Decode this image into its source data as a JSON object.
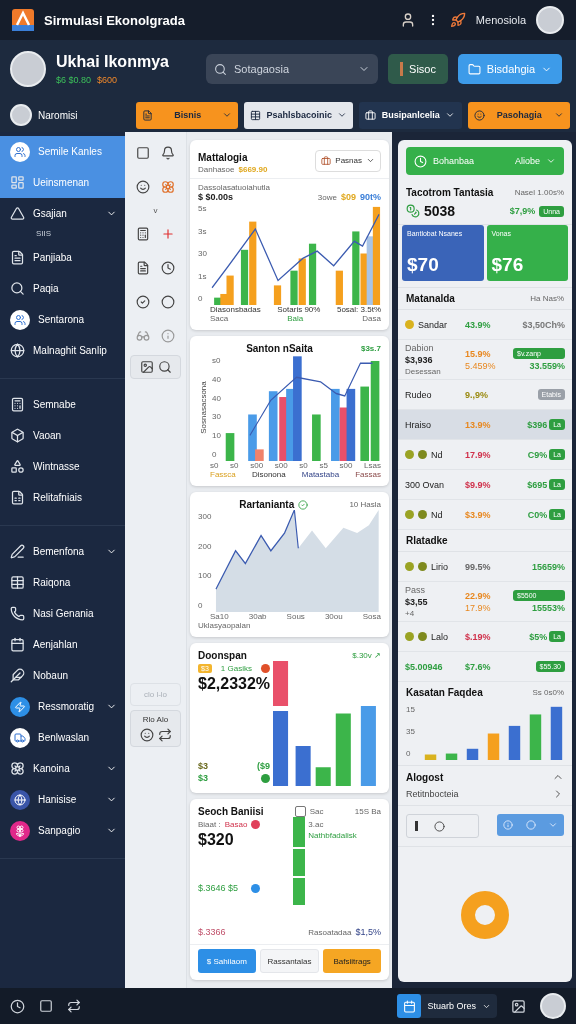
{
  "topbar": {
    "title": "Sirmulasi Ekonolgrada",
    "user_label": "Menosiola"
  },
  "profile": {
    "name": "Ukhai Ikonmya",
    "stat_green": "$6 $0.80",
    "stat_orange": "$600"
  },
  "search": {
    "placeholder": "Sotagaosia"
  },
  "header_buttons": [
    {
      "label": "Sisoc",
      "kind": "plain"
    },
    {
      "label": "Bisdahgia",
      "kind": "dropdown"
    }
  ],
  "subbar": {
    "user": "Naromisi",
    "dropdowns": [
      {
        "label": "Bisnis",
        "color": "#f7931e"
      },
      {
        "label": "Psahlsbacoinic",
        "color": "#e4e7ec"
      },
      {
        "label": "Busipanlcelia",
        "color": "#22344f"
      },
      {
        "label": "Pasohagia",
        "color": "#f7931e"
      }
    ]
  },
  "sidebar": {
    "sections": [
      [
        {
          "label": "Semile Kanles",
          "selected": true,
          "expandable": false,
          "color": "#ffffff"
        },
        {
          "label": "Ueinsmenan",
          "selected": true,
          "expandable": false
        },
        {
          "label": "Gsajian",
          "selected": false,
          "expandable": true,
          "sub": "SIIS"
        },
        {
          "label": "Panjiaba",
          "selected": false,
          "expandable": false
        },
        {
          "label": "Paqia",
          "selected": false,
          "expandable": false
        },
        {
          "label": "Sentarona",
          "selected": false,
          "expandable": false,
          "color": "#ffffff"
        },
        {
          "label": "Malnaghit Sanlip",
          "selected": false,
          "expandable": false
        }
      ],
      [
        {
          "label": "Semnabe",
          "selected": false,
          "expandable": false
        },
        {
          "label": "Vaoan",
          "selected": false,
          "expandable": false
        },
        {
          "label": "Wintnasse",
          "selected": false,
          "expandable": false
        },
        {
          "label": "Relitafniais",
          "selected": false,
          "expandable": false
        }
      ],
      [
        {
          "label": "Bemenfona",
          "selected": false,
          "expandable": true
        },
        {
          "label": "Raiqona",
          "selected": false,
          "expandable": false
        },
        {
          "label": "Nasi Genania",
          "selected": false,
          "expandable": false
        },
        {
          "label": "Aenjahlan",
          "selected": false,
          "expandable": false
        },
        {
          "label": "Nobaun",
          "selected": false,
          "expandable": false
        },
        {
          "label": "Ressmoratig",
          "selected": false,
          "expandable": true,
          "color": "#2d8fe6"
        },
        {
          "label": "Benlwaslan",
          "selected": false,
          "expandable": false,
          "color": "#ffffff"
        },
        {
          "label": "Kanoina",
          "selected": false,
          "expandable": true
        },
        {
          "label": "Hanisise",
          "selected": false,
          "expandable": true,
          "color": "#3a55a8"
        },
        {
          "label": "Sanpagio",
          "selected": false,
          "expandable": true,
          "color": "#e0288a"
        }
      ]
    ]
  },
  "tool_panel": {
    "arrow": "v",
    "faded": "clo l-lo",
    "box_label": "Rlo Alo"
  },
  "trend_card": {
    "title": "Mattalogia",
    "subtitle": "Danhasoe",
    "subtitle_value": "$669.90",
    "dropdown": "Pasnas",
    "caption": "Dassolasatuoiahutla",
    "value": "$ $0.00s",
    "stat_1": "3owe",
    "stat_2": "$09",
    "stat_3": "90t%",
    "yticks": [
      "5s",
      "3s",
      "30",
      "1s",
      "0"
    ],
    "xlabels": [
      "Diasonsbadas",
      "Sotaris 90%",
      "5osal: 3.5t%"
    ],
    "xsublabels": [
      "Saca",
      "Bala",
      "Dasa"
    ]
  },
  "sales_card": {
    "title": "Santon nSaita",
    "value": "$3s.7",
    "ylabel": "Sosnasacsona",
    "yticks": [
      "s0",
      "40",
      "40",
      "30",
      "10",
      "0"
    ],
    "xlabels": [
      "s0",
      "s0",
      "s00",
      "s00",
      "s0",
      "s5",
      "s00",
      "Lsas"
    ],
    "legend": [
      "Fassca",
      "Disonona",
      "Matastaba",
      "Fassas"
    ]
  },
  "area_card": {
    "title": "Rartanianta",
    "meta": "10 Hasla",
    "yticks": [
      "300",
      "200",
      "100",
      "0"
    ],
    "xlabels": [
      "Sa10",
      "30ab",
      "Sous",
      "30ou",
      "Sosa"
    ],
    "caption": "Uklasyaopalan"
  },
  "overview_card": {
    "title": "Doonspan",
    "trend": "$.30v ↗",
    "tag": "$3",
    "tag_text": "1 Gasiks",
    "value": "$2,2332%",
    "mini_1": "$3",
    "mini_2": "($9",
    "mini_3": "$3"
  },
  "summary_card": {
    "title": "Seoch Baniisi",
    "check_label": "Sac",
    "checked": false,
    "meta": "15S Ba",
    "note_label": "Biaat :",
    "note_value": "Basao",
    "note_right": "3.ac",
    "value": "$320",
    "green_value": "$.3646 $5",
    "red_value": "$.3366",
    "bar_top": "Nathbfadalisk",
    "bar_bottom": "Rasoatadaa",
    "bar_pct": "$1,5%",
    "buttons": [
      {
        "label": "$ Sahiiaom",
        "kind": "primary"
      },
      {
        "label": "Rassantalas",
        "kind": "secondary"
      },
      {
        "label": "Bafsiitrags",
        "kind": "warning"
      }
    ]
  },
  "right_panel": {
    "selector": {
      "label": "Bohanbaa",
      "value": "Aliobe"
    },
    "summary": {
      "title": "Tacotrom Tantasia",
      "meta": "Nasel 1.00s%",
      "value": "5038",
      "change": "$7,9%",
      "badge": "Unna"
    },
    "tiles": [
      {
        "label": "Bantlobat Nsanes",
        "value": "$70",
        "color": "#3a64b8"
      },
      {
        "label": "Vonas",
        "value": "$76",
        "color": "#35b04a"
      }
    ],
    "market": {
      "title": "Matanalda",
      "meta": "Ha Nas%",
      "rows": [
        {
          "kind": "icon",
          "label": "Sandar",
          "pct": {
            "text": "43.9%",
            "color": "#2e9e40"
          },
          "value": {
            "text": "$3,50Ch%",
            "color": "#777777"
          },
          "selected": false
        },
        {
          "kind": "stacked",
          "label": "Dabion",
          "label_2": "$3,936",
          "note": "Desessan",
          "pct": {
            "text": "15.9%",
            "color": "#e8871e"
          },
          "pct_2": "5.459%",
          "badge": {
            "text": "$v.zanp",
            "color": "#2e9e40"
          },
          "value": {
            "text": "33.559%",
            "color": "#2e9e40"
          },
          "selected": false
        },
        {
          "kind": "plain",
          "label": "Rudeo",
          "pct": {
            "text": "9.,9%",
            "color": "#9a8a10"
          },
          "badge": {
            "text": "Etabis",
            "color": "#9aa0a8"
          },
          "selected": false
        },
        {
          "kind": "plain",
          "label": "Hraiso",
          "pct": {
            "text": "13.9%",
            "color": "#e8871e"
          },
          "value": {
            "text": "$396",
            "color": "#2e9e40"
          },
          "badge": {
            "text": "La",
            "color": "#2e9e40"
          },
          "selected": true
        },
        {
          "kind": "two_icon",
          "label": "Nd",
          "pct": {
            "text": "17.9%",
            "color": "#d0304a"
          },
          "value": {
            "text": "C9%",
            "color": "#2e9e40"
          },
          "badge": {
            "text": "La",
            "color": "#2e9e40"
          },
          "selected": false
        },
        {
          "kind": "plain",
          "label": "300 Ovan",
          "pct": {
            "text": "$9.9%",
            "color": "#d0304a"
          },
          "value": {
            "text": "$695",
            "color": "#2e9e40"
          },
          "badge": {
            "text": "La",
            "color": "#2e9e40"
          },
          "selected": false
        },
        {
          "kind": "two_icon",
          "label": "Nd",
          "pct": {
            "text": "$3.9%",
            "color": "#e8871e"
          },
          "value": {
            "text": "C0%",
            "color": "#2e9e40"
          },
          "badge": {
            "text": "La",
            "color": "#2e9e40"
          },
          "selected": false
        }
      ]
    },
    "history": {
      "title": "Rlatadke",
      "rows": [
        {
          "kind": "two_icon",
          "label": "Lirio",
          "pct": {
            "text": "99.5%",
            "color": "#666666"
          },
          "value": {
            "text": "15659%",
            "color": "#2e9e40"
          },
          "selected": false
        },
        {
          "kind": "stacked",
          "label": "Pass",
          "label_2": "$3,55",
          "note": "+4",
          "pct": {
            "text": "22.9%",
            "color": "#e8871e"
          },
          "pct_2": "17.9%",
          "badge": {
            "text": "$5500",
            "color": "#2e9e40"
          },
          "value": {
            "text": "15553%",
            "color": "#2e9e40"
          },
          "selected": false
        },
        {
          "kind": "two_icon",
          "label": "Lalo",
          "pct": {
            "text": "$.19%",
            "color": "#d0304a"
          },
          "value": {
            "text": "$5%",
            "color": "#2e9e40"
          },
          "badge": {
            "text": "La",
            "color": "#2e9e40"
          },
          "selected": false
        },
        {
          "kind": "highlight",
          "label": "$5.00946",
          "pct": {
            "text": "$7.6%",
            "color": "#2e9e40"
          },
          "badge": {
            "text": "$55.30",
            "color": "#2e9e40"
          },
          "selected": false
        }
      ]
    },
    "growth": {
      "title": "Kasatan Faqdea",
      "meta": "Ss 0s0%",
      "yticks": [
        "15",
        "35",
        "0"
      ]
    },
    "accordion": {
      "title": "Alogost",
      "expanded": true,
      "item": "Retitnbocteia"
    }
  },
  "bottom_bar": {
    "button": "Stuarb Ores"
  }
}
